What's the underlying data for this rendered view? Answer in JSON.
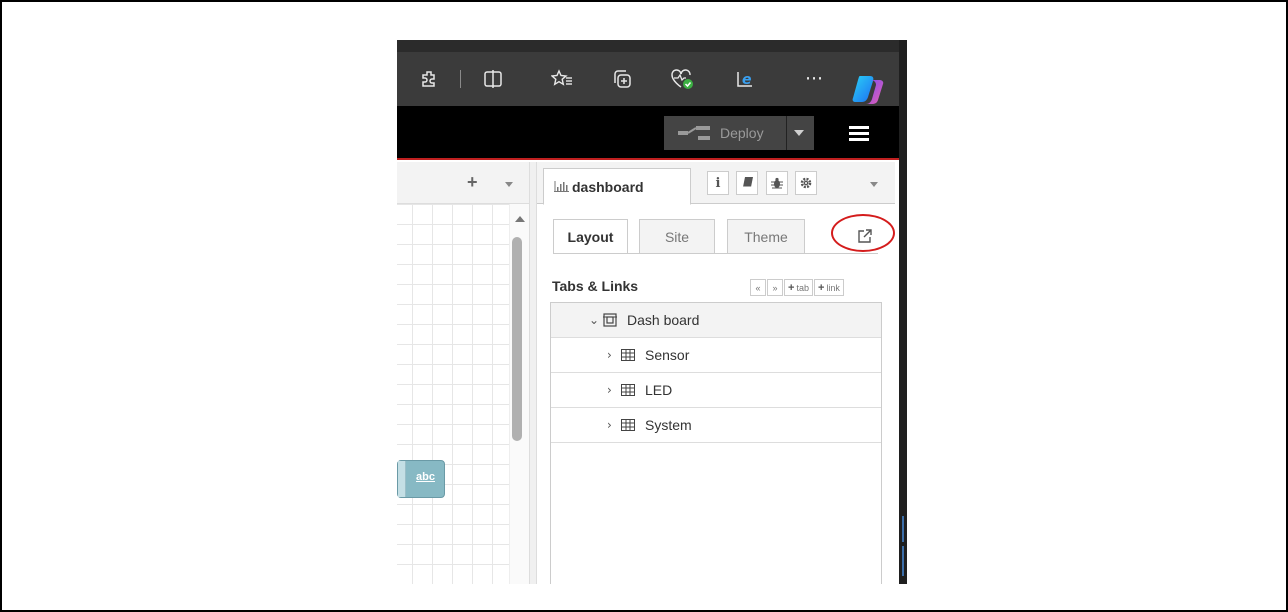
{
  "browser": {
    "toolbar_icons": [
      "extensions-icon",
      "split-screen-icon",
      "favorites-icon",
      "collections-icon",
      "browser-essentials-icon",
      "internet-explorer-mode-icon",
      "more-icon",
      "copilot-icon"
    ],
    "more_label": "···"
  },
  "header": {
    "deploy_label": "Deploy"
  },
  "workspace": {
    "add_tab_label": "+",
    "node_label": "abc"
  },
  "sidebar": {
    "active_tab_label": "dashboard",
    "icon_buttons": [
      "info-icon",
      "book-icon",
      "bug-icon",
      "gear-icon"
    ],
    "subtabs": [
      {
        "label": "Layout",
        "active": true
      },
      {
        "label": "Site",
        "active": false
      },
      {
        "label": "Theme",
        "active": false
      }
    ],
    "tabs_links_title": "Tabs & Links",
    "tl_buttons": {
      "collapse": "«",
      "expand": "»",
      "add_tab": "tab",
      "add_link": "link"
    },
    "tree": {
      "root": {
        "label": "Dash board",
        "expanded": true
      },
      "groups": [
        {
          "label": "Sensor",
          "expanded": false
        },
        {
          "label": "LED",
          "expanded": false
        },
        {
          "label": "System",
          "expanded": false
        }
      ]
    }
  },
  "colors": {
    "header_bg": "#000000",
    "header_accent": "#c02020",
    "annotation_circle": "#d41c1c",
    "node_color": "#87b9c4"
  }
}
